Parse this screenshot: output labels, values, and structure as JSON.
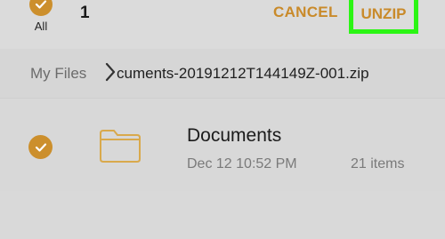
{
  "header": {
    "select_all_label": "All",
    "selected_count": "1",
    "cancel_label": "CANCEL",
    "unzip_label": "UNZIP"
  },
  "breadcrumb": {
    "root": "My Files",
    "current": "cuments-20191212T144149Z-001.zip"
  },
  "items": [
    {
      "name": "Documents",
      "date": "Dec 12 10:52 PM",
      "count": "21 items",
      "selected": true,
      "icon": "folder-icon"
    }
  ],
  "colors": {
    "accent": "#cc8f2c",
    "highlight_box": "#2bf514",
    "background": "#d9d9d9"
  },
  "icons": {
    "check": "check-icon",
    "chevron": "chevron-right-icon",
    "folder": "folder-icon"
  }
}
